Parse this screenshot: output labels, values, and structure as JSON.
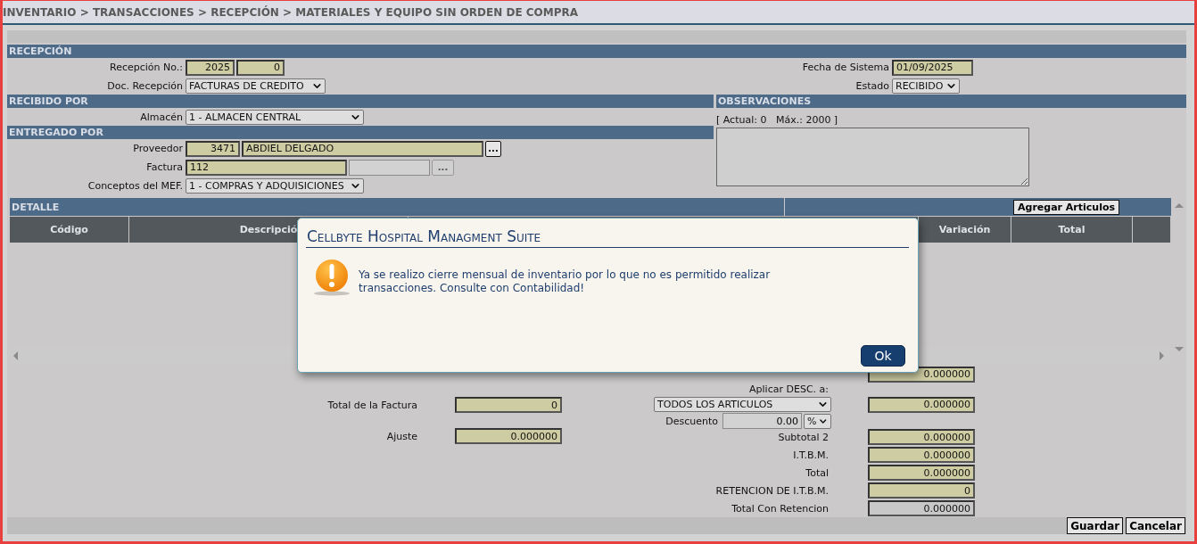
{
  "breadcrumb": "INVENTARIO > TRANSACCIONES > RECEPCIÓN > MATERIALES Y EQUIPO SIN ORDEN DE COMPRA",
  "recepcion": {
    "title": "RECEPCIÓN",
    "numero_label": "Recepción No.:",
    "numero_year": "2025",
    "numero": "0",
    "doc_label": "Doc. Recepción",
    "doc_value": "FACTURAS DE CREDITO",
    "fecha_label": "Fecha de Sistema",
    "fecha": "01/09/2025",
    "estado_label": "Estado",
    "estado": "RECIBIDO"
  },
  "recibido_por": {
    "title": "RECIBIDO POR",
    "almacen_label": "Almacén",
    "almacen": "1 - ALMACEN CENTRAL"
  },
  "entregado_por": {
    "title": "ENTREGADO POR",
    "proveedor_label": "Proveedor",
    "proveedor_code": "3471",
    "proveedor_name": "ABDIEL DELGADO",
    "lookup_button": "...",
    "factura_label": "Factura",
    "factura": "112",
    "factura_lookup": "...",
    "conceptos_label": "Conceptos del MEF.",
    "conceptos": "1 - COMPRAS Y ADQUISICIONES"
  },
  "observaciones": {
    "title": "OBSERVACIONES",
    "counter": "[ Actual: 0   Máx.: 2000 ]"
  },
  "detalle": {
    "title": "DETALLE",
    "add_button": "Agregar Articulos",
    "columns": [
      {
        "label": "Código"
      },
      {
        "label": "Descripció"
      },
      {
        "label": "Variación"
      },
      {
        "label": "Total"
      }
    ]
  },
  "totals": {
    "subtotal1": {
      "value": "0.000000"
    },
    "aplicar_label": "Aplicar DESC. a:",
    "aplicar_value": "TODOS LOS ARTICULOS",
    "descuento_total": "0.000000",
    "descuento_label": "Descuento",
    "descuento_value": "0.00",
    "descuento_unit": "%",
    "left": [
      {
        "label": "Total de la Factura",
        "value": "0"
      },
      {
        "label": "Ajuste",
        "value": "0.000000"
      }
    ],
    "rows": [
      {
        "label": "Subtotal 2",
        "value": "0.000000",
        "disabled": false
      },
      {
        "label": "I.T.B.M.",
        "value": "0.000000",
        "disabled": false
      },
      {
        "label": "Total",
        "value": "0.000000",
        "disabled": false
      },
      {
        "label": "RETENCION DE I.T.B.M.",
        "value": "0",
        "disabled": false
      },
      {
        "label": "Total Con Retencion",
        "value": "0.000000",
        "disabled": true
      }
    ]
  },
  "buttons": [
    "Guardar",
    "Cancelar"
  ],
  "dialog": {
    "title": "Cellbyte Hospital Managment Suite",
    "message": "Ya se realizo cierre mensual de inventario por lo que no es permitido realizar transacciones. Consulte con Contabilidad!",
    "button": "Ok"
  }
}
